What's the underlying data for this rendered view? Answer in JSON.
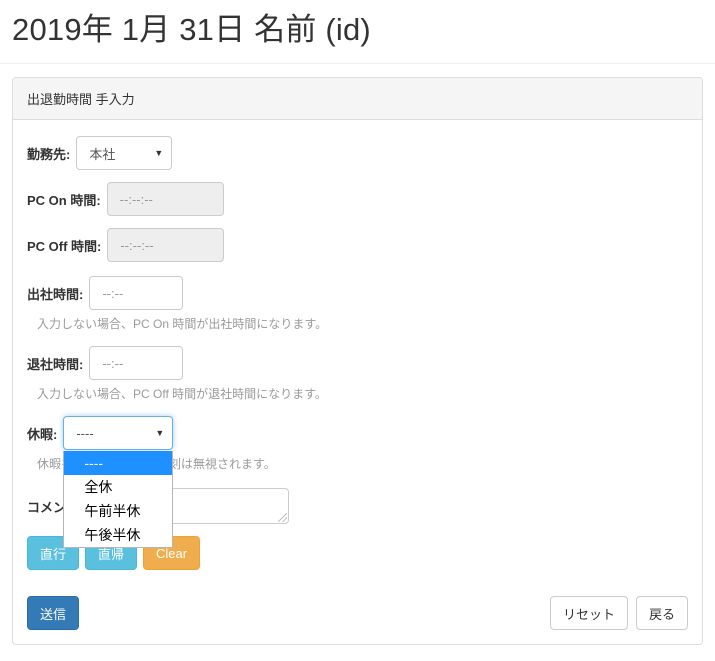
{
  "page": {
    "title": "2019年 1月 31日 名前 (id)"
  },
  "panel": {
    "heading": "出退勤時間 手入力"
  },
  "form": {
    "work_place": {
      "label": "勤務先:",
      "value": "本社"
    },
    "pc_on": {
      "label": "PC On 時間:",
      "value": "--:--:--",
      "disabled": true
    },
    "pc_off": {
      "label": "PC Off 時間:",
      "value": "--:--:--",
      "disabled": true
    },
    "arrive": {
      "label": "出社時間:",
      "value": "--:--",
      "help": "入力しない場合、PC On 時間が出社時間になります。"
    },
    "leave": {
      "label": "退社時間:",
      "value": "--:--",
      "help": "入力しない場合、PC Off 時間が退社時間になります。"
    },
    "holiday": {
      "label": "休暇:",
      "value": "----",
      "help": "休暇を選択した場合、時刻は無視されます。",
      "options": [
        "----",
        "全休",
        "午前半休",
        "午後半休"
      ],
      "selected_index": 0,
      "expanded": true
    },
    "comment": {
      "label": "コメント:",
      "value": "",
      "placeholder": ""
    }
  },
  "quick_buttons": {
    "direct_go": "直行",
    "direct_return": "直帰",
    "clear": "Clear"
  },
  "footer": {
    "submit": "送信",
    "reset": "リセット",
    "back": "戻る"
  },
  "icons": {
    "caret_down": "▼"
  },
  "colors": {
    "primary": "#337ab7",
    "info": "#5bc0de",
    "warning": "#f0ad4e",
    "panel_header_bg": "#f5f5f5",
    "border": "#dddddd",
    "focus_ring": "#66afe9",
    "dropdown_highlight": "#1e90ff",
    "disabled_bg": "#eeeeee",
    "help_text": "#9a9a9a"
  }
}
